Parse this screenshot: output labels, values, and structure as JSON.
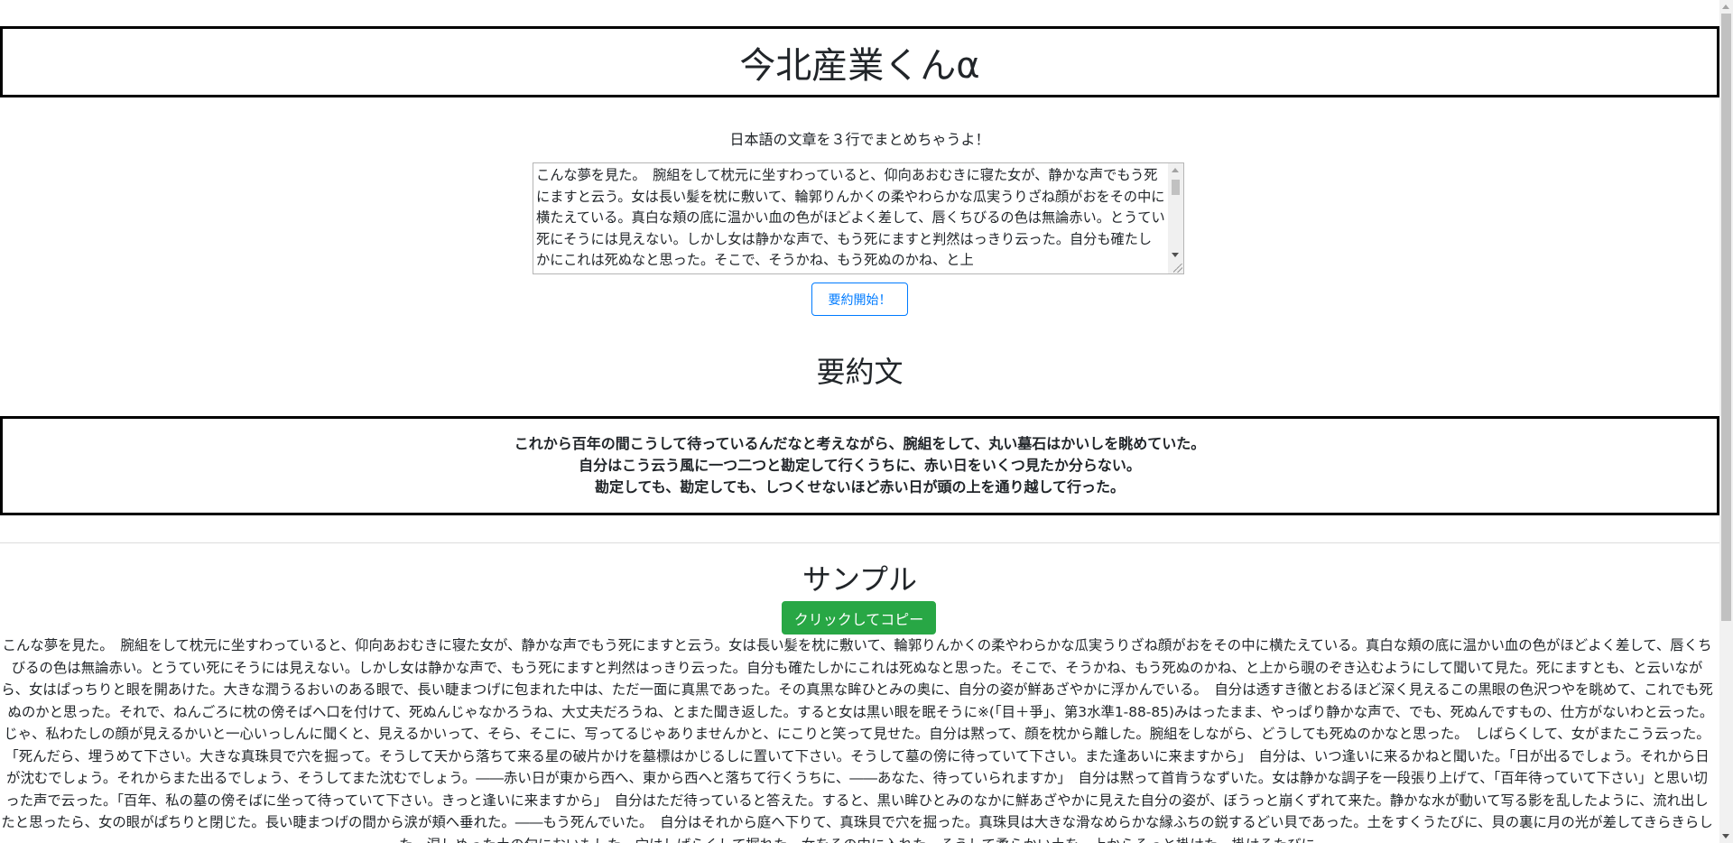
{
  "header": {
    "title": "今北産業くんα"
  },
  "input": {
    "subtitle": "日本語の文章を３行でまとめちゃうよ！",
    "text": "こんな夢を見た。　腕組をして枕元に坐すわっていると、仰向あおむきに寝た女が、静かな声でもう死にますと云う。女は長い髪を枕に敷いて、輪郭りんかくの柔やわらかな瓜実うりざね顔がおをその中に横たえている。真白な頬の底に温かい血の色がほどよく差して、唇くちびるの色は無論赤い。とうてい死にそうには見えない。しかし女は静かな声で、もう死にますと判然はっきり云った。自分も確たしかにこれは死ぬなと思った。そこで、そうかね、もう死ぬのかね、と上",
    "submit_label": "要約開始！"
  },
  "summary": {
    "heading": "要約文",
    "lines": [
      "これから百年の間こうして待っているんだなと考えながら、腕組をして、丸い墓石はかいしを眺めていた。",
      "自分はこう云う風に一つ二つと勘定して行くうちに、赤い日をいくつ見たか分らない。",
      "勘定しても、勘定しても、しつくせないほど赤い日が頭の上を通り越して行った。"
    ]
  },
  "sample": {
    "heading": "サンプル",
    "copy_label": "クリックしてコピー",
    "text": "こんな夢を見た。　腕組をして枕元に坐すわっていると、仰向あおむきに寝た女が、静かな声でもう死にますと云う。女は長い髪を枕に敷いて、輪郭りんかくの柔やわらかな瓜実うりざね顔がおをその中に横たえている。真白な頬の底に温かい血の色がほどよく差して、唇くちびるの色は無論赤い。とうてい死にそうには見えない。しかし女は静かな声で、もう死にますと判然はっきり云った。自分も確たしかにこれは死ぬなと思った。そこで、そうかね、もう死ぬのかね、と上から覗のぞき込むようにして聞いて見た。死にますとも、と云いながら、女はぱっちりと眼を開あけた。大きな潤うるおいのある眼で、長い睫まつげに包まれた中は、ただ一面に真黒であった。その真黒な眸ひとみの奥に、自分の姿が鮮あざやかに浮かんでいる。　自分は透すき徹とおるほど深く見えるこの黒眼の色沢つやを眺めて、これでも死ぬのかと思った。それで、ねんごろに枕の傍そばへ口を付けて、死ぬんじゃなかろうね、大丈夫だろうね、とまた聞き返した。すると女は黒い眼を眠そうに※(「目＋爭」、第3水準1-88-85)みはったまま、やっぱり静かな声で、でも、死ぬんですもの、仕方がないわと云った。　じゃ、私わたしの顔が見えるかいと一心いっしんに聞くと、見えるかいって、そら、そこに、写ってるじゃありませんかと、にこりと笑って見せた。自分は黙って、顔を枕から離した。腕組をしながら、どうしても死ぬのかなと思った。　しばらくして、女がまたこう云った。「死んだら、埋うめて下さい。大きな真珠貝で穴を掘って。そうして天から落ちて来る星の破片かけを墓標はかじるしに置いて下さい。そうして墓の傍に待っていて下さい。また逢あいに来ますから」　自分は、いつ逢いに来るかねと聞いた。「日が出るでしょう。それから日が沈むでしょう。それからまた出るでしょう、そうしてまた沈むでしょう。――赤い日が東から西へ、東から西へと落ちて行くうちに、――あなた、待っていられますか」　自分は黙って首肯うなずいた。女は静かな調子を一段張り上げて、「百年待っていて下さい」と思い切った声で云った。「百年、私の墓の傍そばに坐って待っていて下さい。きっと逢いに来ますから」　自分はただ待っていると答えた。すると、黒い眸ひとみのなかに鮮あざやかに見えた自分の姿が、ぼうっと崩くずれて来た。静かな水が動いて写る影を乱したように、流れ出したと思ったら、女の眼がぱちりと閉じた。長い睫まつげの間から涙が頬へ垂れた。――もう死んでいた。　自分はそれから庭へ下りて、真珠貝で穴を掘った。真珠貝は大きな滑なめらかな縁ふちの鋭するどい貝であった。土をすくうたびに、貝の裏に月の光が差してきらきらした。湿しめった土の匂においもした。穴はしばらくして掘れた。女をその中に入れた。そうして柔らかい土を、上からそっと掛けた。掛けるたびに"
  },
  "colors": {
    "primary": "#007bff",
    "success": "#28a745",
    "border": "#000000"
  }
}
